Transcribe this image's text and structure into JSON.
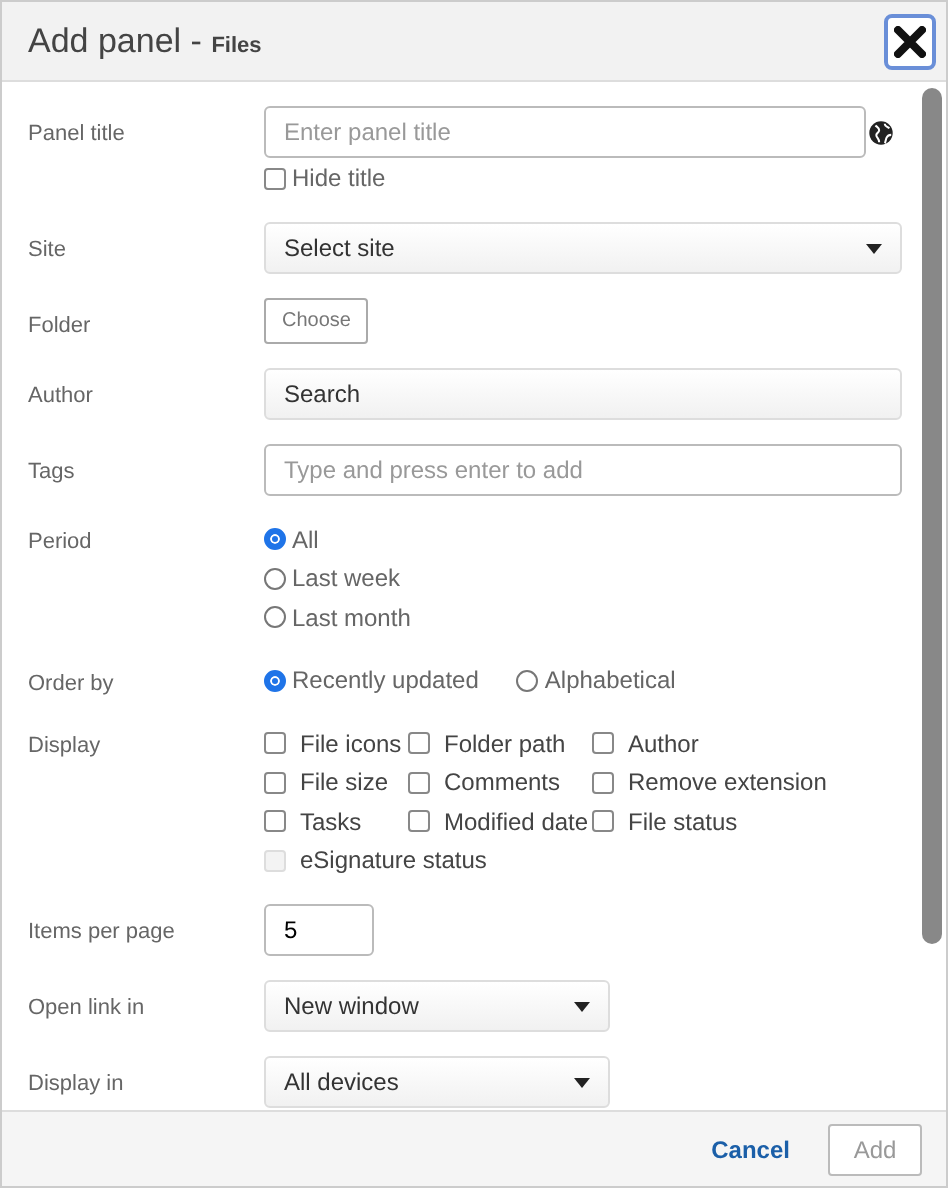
{
  "dialog": {
    "title": "Add panel - ",
    "subtitle": "Files"
  },
  "fields": [
    {
      "kind": "text",
      "label": "Panel title",
      "placeholder": "Enter panel title",
      "checkbox": {
        "label": "Hide title",
        "checked": false
      }
    },
    {
      "kind": "select",
      "label": "Site",
      "value": "Select site",
      "wide": true
    },
    {
      "kind": "button",
      "label": "Folder",
      "value": "Choose"
    },
    {
      "kind": "search",
      "label": "Author",
      "value": "Search"
    },
    {
      "kind": "input",
      "label": "Tags",
      "placeholder": "Type and press enter to add"
    },
    {
      "kind": "radios",
      "label": "Period",
      "inline": false,
      "options": [
        {
          "label": "All",
          "selected": true
        },
        {
          "label": "Last week",
          "selected": false
        },
        {
          "label": "Last month",
          "selected": false
        }
      ]
    },
    {
      "kind": "radios",
      "label": "Order by",
      "inline": true,
      "options": [
        {
          "label": "Recently updated",
          "selected": true
        },
        {
          "label": "Alphabetical",
          "selected": false
        }
      ]
    },
    {
      "kind": "checks",
      "label": "Display",
      "options": [
        {
          "label": "File icons",
          "checked": false,
          "disabled": false
        },
        {
          "label": "Folder path",
          "checked": false,
          "disabled": false
        },
        {
          "label": "Author",
          "checked": false,
          "disabled": false
        },
        {
          "label": "File size",
          "checked": false,
          "disabled": false
        },
        {
          "label": "Comments",
          "checked": false,
          "disabled": false
        },
        {
          "label": "Remove extension",
          "checked": false,
          "disabled": false
        },
        {
          "label": "Tasks",
          "checked": false,
          "disabled": false
        },
        {
          "label": "Modified date",
          "checked": false,
          "disabled": false
        },
        {
          "label": "File status",
          "checked": false,
          "disabled": false
        },
        {
          "label": "eSignature status",
          "checked": false,
          "disabled": true
        }
      ]
    },
    {
      "kind": "number",
      "label": "Items per page",
      "value": "5"
    },
    {
      "kind": "select",
      "label": "Open link in",
      "value": "New window",
      "wide": false
    },
    {
      "kind": "select",
      "label": "Display in",
      "value": "All devices",
      "wide": false
    }
  ],
  "footer": {
    "cancel": "Cancel",
    "add": "Add",
    "add_disabled": true
  }
}
